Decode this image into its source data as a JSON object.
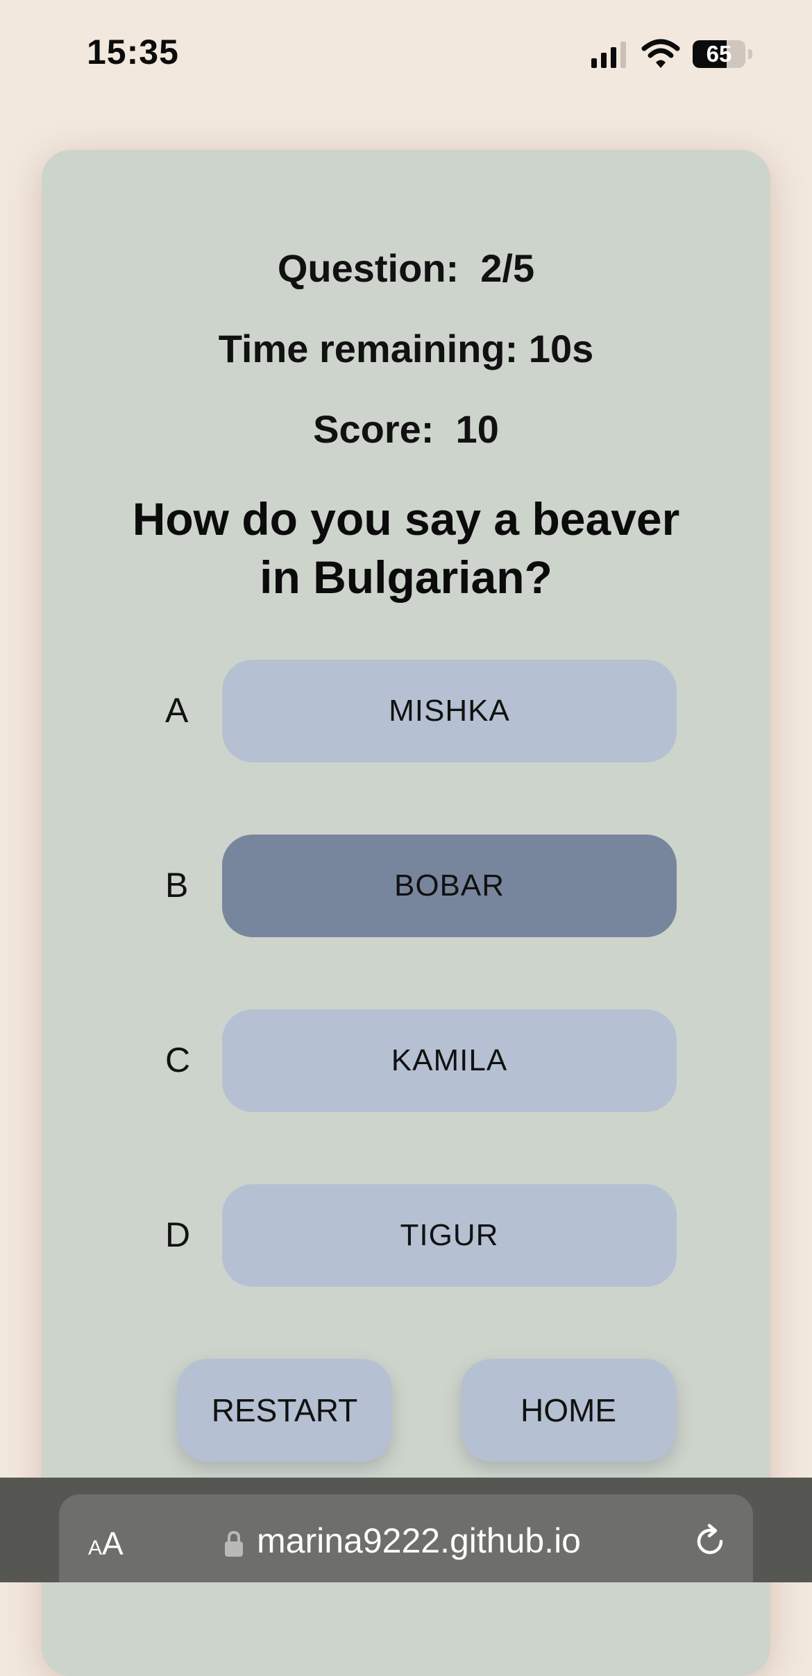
{
  "status_bar": {
    "time": "15:35",
    "battery_text": "65",
    "battery_level": 0.65,
    "signal_icon": "cellular-signal-icon",
    "wifi_icon": "wifi-icon",
    "battery_icon": "battery-icon"
  },
  "quiz": {
    "question_counter": "Question:  2/5",
    "time_remaining": "Time remaining: 10s",
    "score": "Score:  10",
    "question": "How do you say a beaver in Bulgarian?",
    "answers": [
      {
        "letter": "A",
        "label": "MISHKA",
        "selected": false
      },
      {
        "letter": "B",
        "label": "BOBAR",
        "selected": true
      },
      {
        "letter": "C",
        "label": "KAMILA",
        "selected": false
      },
      {
        "letter": "D",
        "label": "TIGUR",
        "selected": false
      }
    ],
    "restart_label": "RESTART",
    "home_label": "HOME"
  },
  "browser": {
    "text_size_label_small": "A",
    "text_size_label_large": "A",
    "url": "marina9222.github.io",
    "lock_icon": "lock-icon",
    "reload_icon": "reload-icon"
  },
  "colors": {
    "page_background": "#f2e8de",
    "card_background": "#cdd4cc",
    "answer_button": "#b5c1d2",
    "answer_button_selected": "#78869d",
    "browser_bar": "#565652",
    "url_pill": "#6e6f6b"
  }
}
